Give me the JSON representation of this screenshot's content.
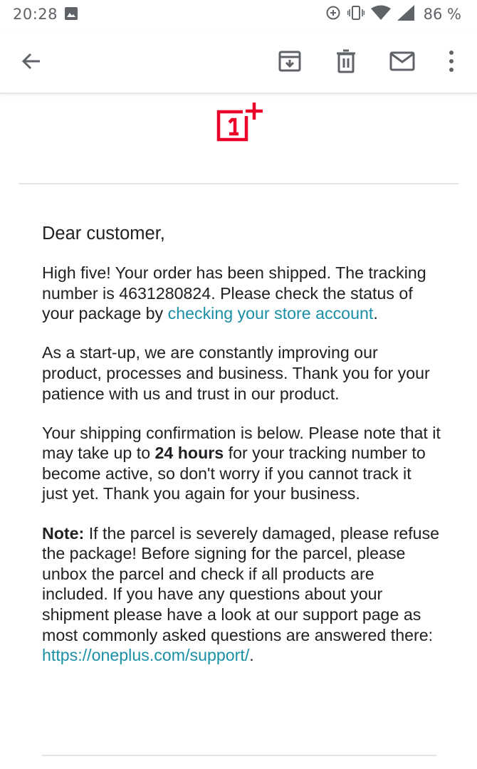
{
  "status_bar": {
    "time": "20:28",
    "battery_percent": "86 %",
    "icons": [
      "image-icon",
      "data-saver-icon",
      "vibrate-icon",
      "wifi-icon",
      "signal-icon"
    ]
  },
  "toolbar": {
    "icons": [
      "back-arrow-icon",
      "archive-icon",
      "trash-icon",
      "mail-icon",
      "more-vert-icon"
    ]
  },
  "colors": {
    "brand_red": "#eb0028",
    "link": "#1a8fa6",
    "text": "#202124",
    "icon": "#5f6368"
  },
  "email": {
    "logo_icon": "oneplus-logo-icon",
    "greeting": "Dear customer,",
    "paragraph1": {
      "text": "High five! Your order has been shipped. The tracking number is 4631280824. Please check the status of your package by ",
      "link_text": "checking your store account",
      "after": "."
    },
    "paragraph2": "As a start-up, we are constantly improving our product, processes and business. Thank you for your patience with us and trust in our product.",
    "paragraph3": {
      "before": "Your shipping confirmation is below. Please note that it may take up to ",
      "bold": "24 hours",
      "after": " for your tracking number to become active, so don't worry if you cannot track it just yet. Thank you again for your business."
    },
    "paragraph4": {
      "label": "Note:",
      "text": " If the parcel is severely damaged, please refuse the package! Before signing for the parcel, please unbox the parcel and check if all products are included. If you have any questions about your shipment please have a look at our support page as most commonly asked questions are answered there: ",
      "link_text": "https://oneplus.com/support/",
      "after": "."
    }
  }
}
